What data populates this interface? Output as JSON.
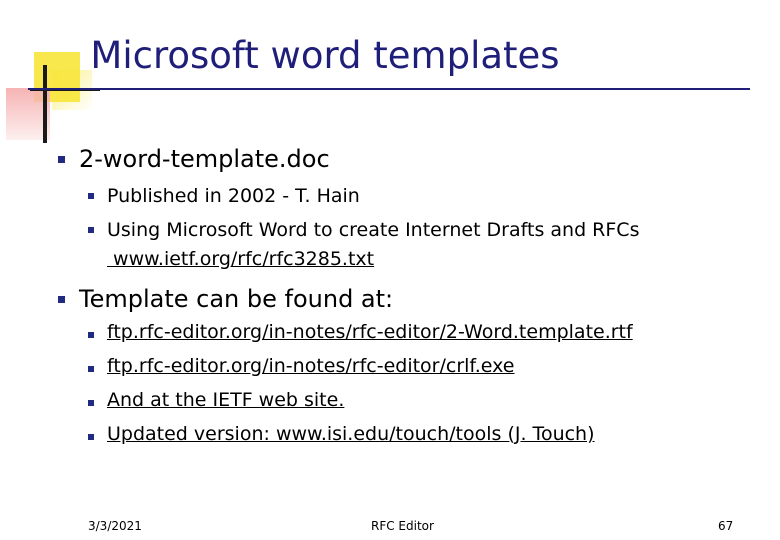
{
  "slide": {
    "title": "Microsoft word templates",
    "bullets": [
      {
        "text": "2-word-template.doc",
        "children": [
          "Published in 2002 - T. Hain",
          "Using Microsoft Word to create Internet Drafts and RFCs"
        ],
        "link": " www.ietf.org/rfc/rfc3285.txt"
      },
      {
        "text": "Template can be found at:",
        "children": [
          "ftp.rfc-editor.org/in-notes/rfc-editor/2-Word.template.rtf",
          "ftp.rfc-editor.org/in-notes/rfc-editor/crlf.exe",
          "And at the IETF web site.",
          "Updated version: www.isi.edu/touch/tools (J. Touch)"
        ]
      }
    ]
  },
  "footer": {
    "date": "3/3/2021",
    "center": "RFC Editor",
    "page": "67"
  },
  "colors": {
    "title": "#1f1f7a",
    "bullet": "#1f2a80",
    "accent_yellow": "#f7e63a",
    "accent_pink": "#f6b3b3"
  }
}
